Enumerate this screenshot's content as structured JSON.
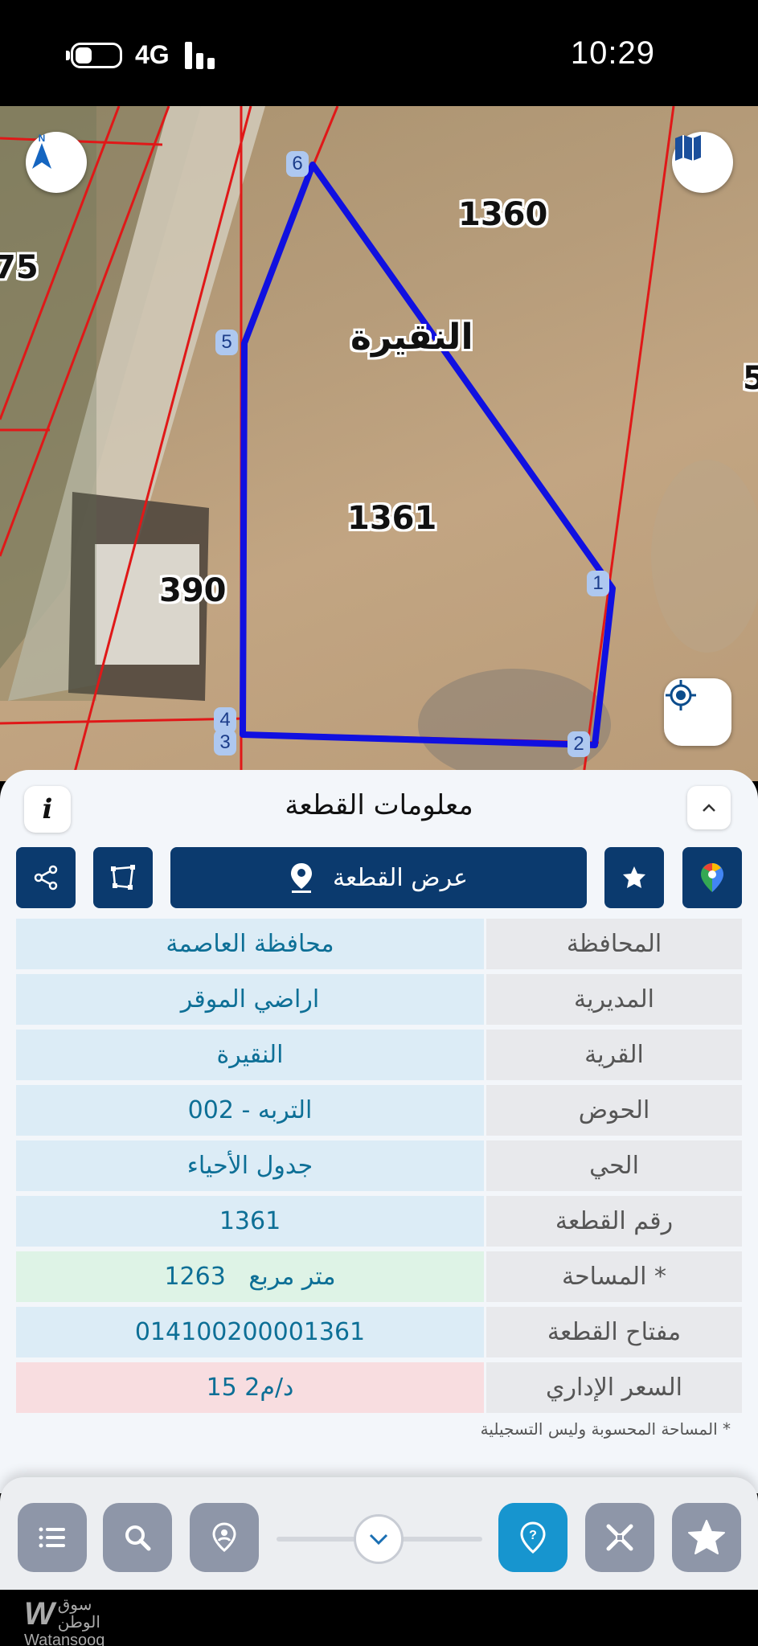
{
  "status_bar": {
    "network": "4G",
    "time": "10:29"
  },
  "map": {
    "parcel_labels": [
      "1360",
      "1361",
      "390",
      "75",
      "5"
    ],
    "area_label": "النقيرة",
    "vertex_labels": [
      "1",
      "2",
      "3",
      "4",
      "5",
      "6"
    ],
    "colors": {
      "parcel_outline": "#1010e0",
      "boundaries": "#e01818"
    },
    "compass_icon": "north-arrow-icon",
    "layers_icon": "map-icon",
    "locate_icon": "crosshair-icon"
  },
  "sheet": {
    "title": "معلومات القطعة",
    "info_label": "i",
    "show_parcel_label": "عرض القطعة",
    "accent": "#0b3a6e",
    "rows": [
      {
        "label": "المحافظة",
        "value": "محافظة العاصمة"
      },
      {
        "label": "المديرية",
        "value": "اراضي الموقر"
      },
      {
        "label": "القرية",
        "value": "النقيرة"
      },
      {
        "label": "الحوض",
        "value": "التربه - 002"
      },
      {
        "label": "الحي",
        "value": "جدول الأحياء"
      },
      {
        "label": "رقم القطعة",
        "value": "1361"
      },
      {
        "label": "المساحة *",
        "value": "1263   متر مربع"
      },
      {
        "label": "مفتاح القطعة",
        "value": "014100200001361"
      },
      {
        "label": "السعر الإداري",
        "value": "15 د/م2"
      }
    ],
    "footnote": "* المساحة المحسوبة وليس التسجيلية"
  },
  "toolbar": {
    "active_color": "#1795cf"
  },
  "watermark": {
    "arabic": "سوق الوطن",
    "latin": "Watansooq"
  }
}
